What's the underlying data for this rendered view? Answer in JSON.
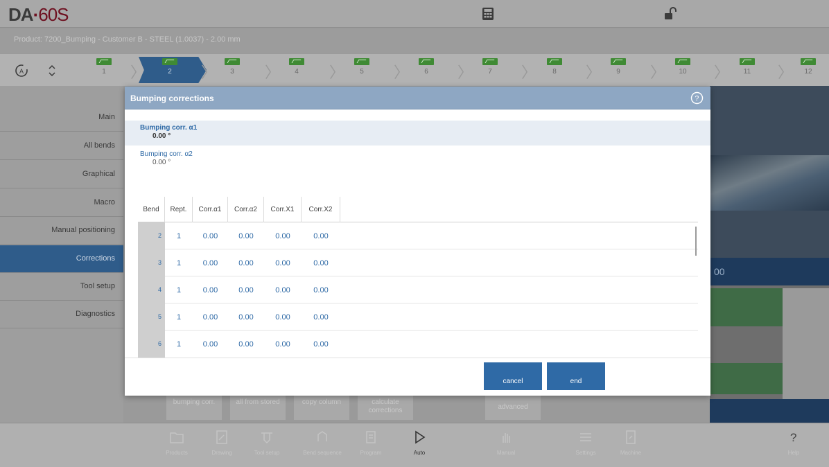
{
  "header": {
    "logo_brand": "DA",
    "logo_dot": "·",
    "logo_model": "60S",
    "product_line": "Product: 7200_Bumping - Customer B - STEEL (1.0037) - 2.00 mm"
  },
  "steps": {
    "numbers": [
      "1",
      "2",
      "3",
      "4",
      "5",
      "6",
      "7",
      "8",
      "9",
      "10",
      "11",
      "12"
    ],
    "active": "2"
  },
  "sidebar": {
    "items": [
      {
        "label": "Main"
      },
      {
        "label": "All bends"
      },
      {
        "label": "Graphical"
      },
      {
        "label": "Macro"
      },
      {
        "label": "Manual positioning"
      },
      {
        "label": "Corrections"
      },
      {
        "label": "Tool setup"
      },
      {
        "label": "Diagnostics"
      }
    ],
    "active": "Corrections"
  },
  "background": {
    "axis_value": "00",
    "buttons": [
      {
        "label": "bumping corr."
      },
      {
        "label": "all from stored"
      },
      {
        "label": "copy column"
      },
      {
        "label": "calculate corrections"
      },
      {
        "label": "advanced"
      }
    ]
  },
  "dialog": {
    "title": "Bumping corrections",
    "params": [
      {
        "label": "Bumping corr. α1",
        "value": "0.00 °"
      },
      {
        "label": "Bumping corr. α2",
        "value": "0.00 °"
      }
    ],
    "table": {
      "columns": [
        "Bend",
        "Rept.",
        "Corr.α1",
        "Corr.α2",
        "Corr.X1",
        "Corr.X2"
      ],
      "rows": [
        {
          "bend": "2",
          "rept": "1",
          "a1": "0.00",
          "a2": "0.00",
          "x1": "0.00",
          "x2": "0.00"
        },
        {
          "bend": "3",
          "rept": "1",
          "a1": "0.00",
          "a2": "0.00",
          "x1": "0.00",
          "x2": "0.00"
        },
        {
          "bend": "4",
          "rept": "1",
          "a1": "0.00",
          "a2": "0.00",
          "x1": "0.00",
          "x2": "0.00"
        },
        {
          "bend": "5",
          "rept": "1",
          "a1": "0.00",
          "a2": "0.00",
          "x1": "0.00",
          "x2": "0.00"
        },
        {
          "bend": "6",
          "rept": "1",
          "a1": "0.00",
          "a2": "0.00",
          "x1": "0.00",
          "x2": "0.00"
        }
      ]
    },
    "cancel_label": "cancel",
    "end_label": "end"
  },
  "toolbar": {
    "items": [
      {
        "label": "Products"
      },
      {
        "label": "Drawing"
      },
      {
        "label": "Tool setup"
      },
      {
        "label": "Bend sequence"
      },
      {
        "label": "Program"
      },
      {
        "label": "Auto"
      },
      {
        "label": "Manual"
      },
      {
        "label": "Settings"
      },
      {
        "label": "Machine"
      },
      {
        "label": "Help"
      }
    ]
  },
  "colors": {
    "accent_blue": "#2f5c8a",
    "button_blue": "#2f6aa6",
    "dialog_header": "#8ea7c3",
    "step_green": "#3f8a34",
    "brand_red": "#6e1020"
  },
  "icons": {
    "header": [
      "calculator-icon",
      "unlock-icon"
    ],
    "steps_left": [
      "cycle-icon",
      "up-down-arrow-icon"
    ],
    "dialog": [
      "help-icon"
    ]
  }
}
